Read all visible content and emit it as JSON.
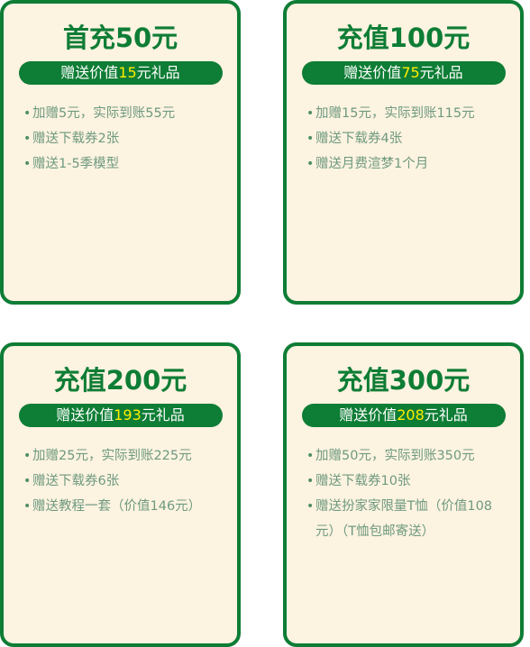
{
  "cards": [
    {
      "title": "首充50元",
      "badge": {
        "prefix": "赠送价值",
        "amount": "15",
        "suffix": "元礼品"
      },
      "perks": [
        "加赠5元，实际到账55元",
        "赠送下载券2张",
        "赠送1-5季模型"
      ]
    },
    {
      "title": "充值100元",
      "badge": {
        "prefix": "赠送价值",
        "amount": "75",
        "suffix": "元礼品"
      },
      "perks": [
        "加赠15元，实际到账115元",
        "赠送下载券4张",
        "赠送月费渲梦1个月"
      ]
    },
    {
      "title": "充值200元",
      "badge": {
        "prefix": "赠送价值",
        "amount": "193",
        "suffix": "元礼品"
      },
      "perks": [
        "加赠25元，实际到账225元",
        "赠送下载券6张",
        "赠送教程一套（价值146元）"
      ]
    },
    {
      "title": "充值300元",
      "badge": {
        "prefix": "赠送价值",
        "amount": "208",
        "suffix": "元礼品"
      },
      "perks": [
        "加赠50元，实际到账350元",
        "赠送下载券10张",
        "赠送扮家家限量T恤（价值108元）（T恤包邮寄送）"
      ]
    }
  ],
  "colors": {
    "brand_green": "#0e7d35",
    "card_background": "#fdf3e1",
    "amount_highlight": "#ffee00",
    "perk_text": "#6e9a7f"
  },
  "icons": {
    "bullet": "bullet-dot-icon"
  }
}
